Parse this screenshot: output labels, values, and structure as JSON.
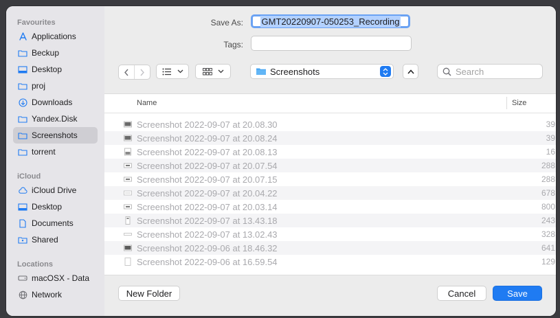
{
  "sidebar": {
    "favourites_title": "Favourites",
    "favourites": [
      {
        "label": "Applications",
        "icon": "applications-icon"
      },
      {
        "label": "Beckup",
        "icon": "folder-icon"
      },
      {
        "label": "Desktop",
        "icon": "desktop-icon"
      },
      {
        "label": "proj",
        "icon": "folder-icon"
      },
      {
        "label": "Downloads",
        "icon": "downloads-icon"
      },
      {
        "label": "Yandex.Disk",
        "icon": "folder-icon"
      },
      {
        "label": "Screenshots",
        "icon": "folder-icon",
        "selected": true
      },
      {
        "label": "torrent",
        "icon": "folder-icon"
      }
    ],
    "icloud_title": "iCloud",
    "icloud": [
      {
        "label": "iCloud Drive",
        "icon": "cloud-icon"
      },
      {
        "label": "Desktop",
        "icon": "desktop-icon"
      },
      {
        "label": "Documents",
        "icon": "document-icon"
      },
      {
        "label": "Shared",
        "icon": "shared-folder-icon"
      }
    ],
    "locations_title": "Locations",
    "locations": [
      {
        "label": "macOSX - Data",
        "icon": "drive-icon"
      },
      {
        "label": "Network",
        "icon": "globe-icon"
      }
    ]
  },
  "form": {
    "save_as_label": "Save As:",
    "save_as_value": "GMT20220907-050253_Recording",
    "tags_label": "Tags:",
    "tags_value": ""
  },
  "toolbar": {
    "location": "Screenshots",
    "search_placeholder": "Search"
  },
  "file_list": {
    "col_name": "Name",
    "col_size": "Size",
    "files": [
      {
        "name": "Screenshot 2022-09-07 at 20.08.30",
        "size": "39"
      },
      {
        "name": "Screenshot 2022-09-07 at 20.08.24",
        "size": "39"
      },
      {
        "name": "Screenshot 2022-09-07 at 20.08.13",
        "size": "16"
      },
      {
        "name": "Screenshot 2022-09-07 at 20.07.54",
        "size": "288"
      },
      {
        "name": "Screenshot 2022-09-07 at 20.07.15",
        "size": "288"
      },
      {
        "name": "Screenshot 2022-09-07 at 20.04.22",
        "size": "678"
      },
      {
        "name": "Screenshot 2022-09-07 at 20.03.14",
        "size": "800"
      },
      {
        "name": "Screenshot 2022-09-07 at 13.43.18",
        "size": "243"
      },
      {
        "name": "Screenshot 2022-09-07 at 13.02.43",
        "size": "328"
      },
      {
        "name": "Screenshot 2022-09-06 at 18.46.32",
        "size": "641"
      },
      {
        "name": "Screenshot 2022-09-06 at 16.59.54",
        "size": "129"
      }
    ]
  },
  "buttons": {
    "new_folder": "New Folder",
    "cancel": "Cancel",
    "save": "Save"
  },
  "colors": {
    "accent": "#1f7bf2",
    "sidebar_bg": "#e6e5e9",
    "selection": "#cfced3"
  }
}
